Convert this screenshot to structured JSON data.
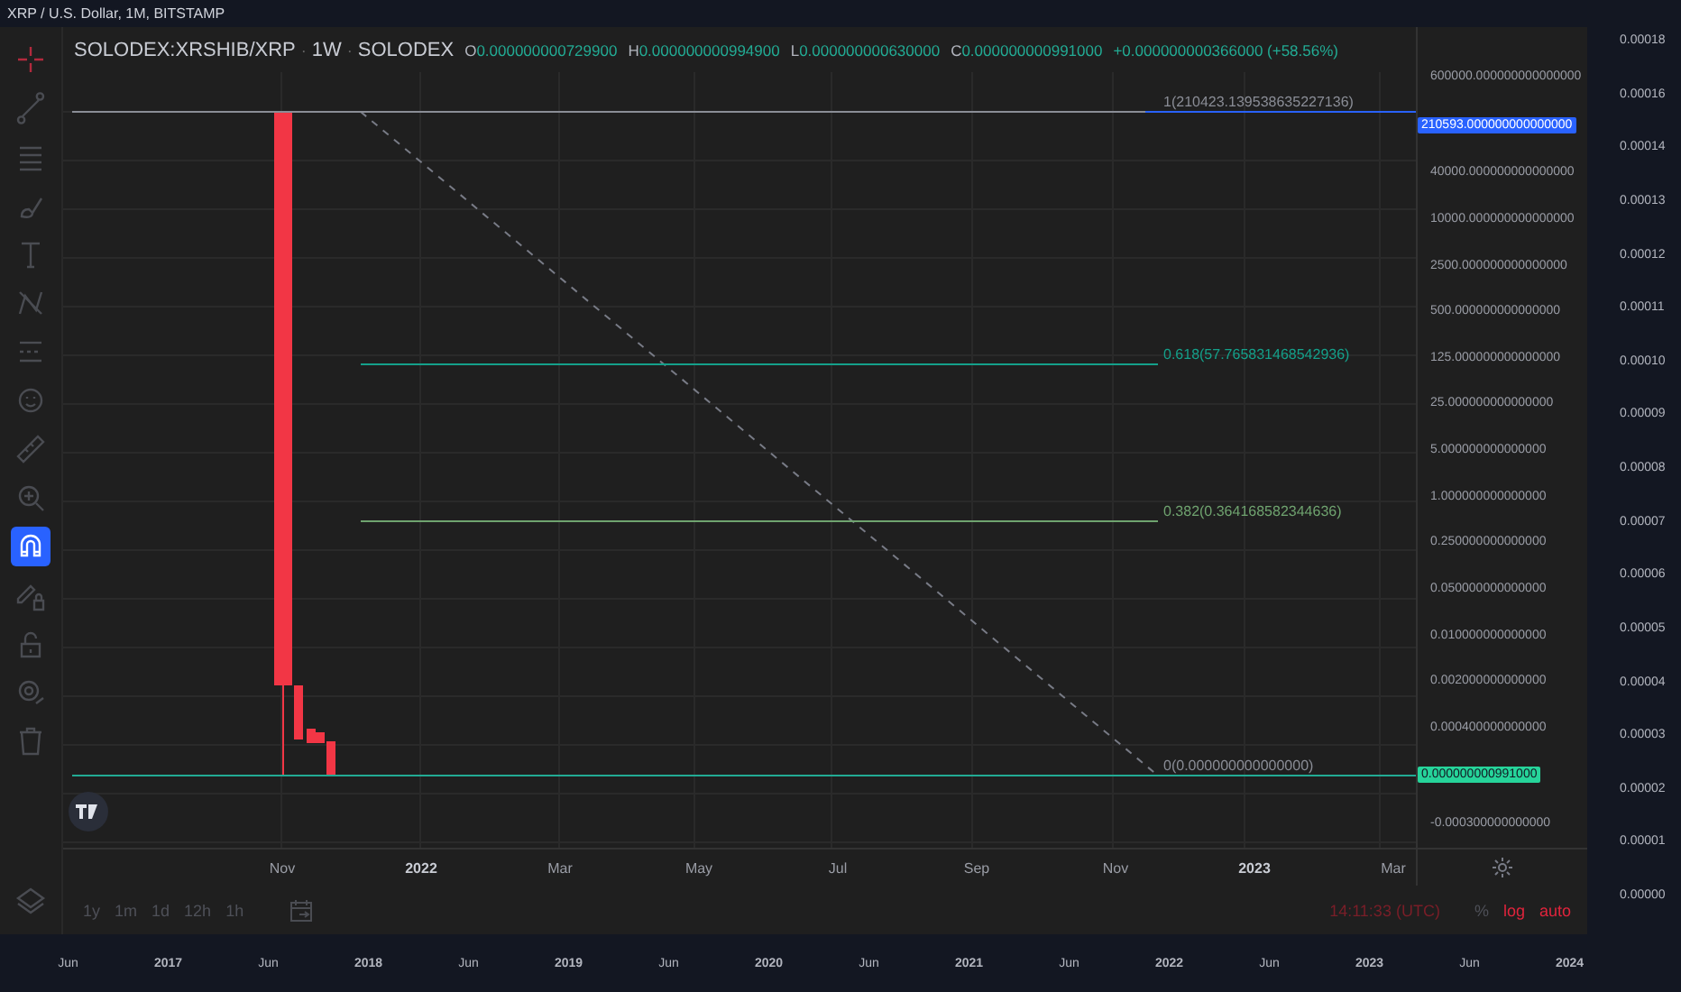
{
  "outer_title": "XRP / U.S. Dollar, 1M, BITSTAMP",
  "outer_price_axis": [
    "0.00018",
    "0.00016",
    "0.00014",
    "0.00013",
    "0.00012",
    "0.00011",
    "0.00010",
    "0.00009",
    "0.00008",
    "0.00007",
    "0.00006",
    "0.00005",
    "0.00004",
    "0.00003",
    "0.00002",
    "0.00001",
    "0.00000"
  ],
  "outer_time_axis": [
    {
      "text": "Jun",
      "kind": "month"
    },
    {
      "text": "2017",
      "kind": "year"
    },
    {
      "text": "Jun",
      "kind": "month"
    },
    {
      "text": "2018",
      "kind": "year"
    },
    {
      "text": "Jun",
      "kind": "month"
    },
    {
      "text": "2019",
      "kind": "year"
    },
    {
      "text": "Jun",
      "kind": "month"
    },
    {
      "text": "2020",
      "kind": "year"
    },
    {
      "text": "Jun",
      "kind": "month"
    },
    {
      "text": "2021",
      "kind": "year"
    },
    {
      "text": "Jun",
      "kind": "month"
    },
    {
      "text": "2022",
      "kind": "year"
    },
    {
      "text": "Jun",
      "kind": "month"
    },
    {
      "text": "2023",
      "kind": "year"
    },
    {
      "text": "Jun",
      "kind": "month"
    },
    {
      "text": "2024",
      "kind": "year"
    }
  ],
  "tools": [
    {
      "kind": "crosshair",
      "selected": false
    },
    {
      "kind": "line",
      "selected": false
    },
    {
      "kind": "hlines",
      "selected": false
    },
    {
      "kind": "brush",
      "selected": false
    },
    {
      "kind": "text",
      "selected": false
    },
    {
      "kind": "zigzag",
      "selected": false
    },
    {
      "kind": "dotted",
      "selected": false
    },
    {
      "kind": "smiley",
      "selected": false
    },
    {
      "kind": "ruler",
      "selected": false
    },
    {
      "kind": "zoom",
      "selected": false
    },
    {
      "kind": "magnet",
      "selected": true
    },
    {
      "kind": "pencil-lock",
      "selected": false
    },
    {
      "kind": "lock",
      "selected": false
    },
    {
      "kind": "eye",
      "selected": false
    },
    {
      "kind": "trash",
      "selected": false
    },
    {
      "kind": "layers",
      "selected": false
    }
  ],
  "legend": {
    "separator": "·",
    "symbol": "SOLODEX:XRSHIB/XRP",
    "interval": "1W",
    "exchange": "SOLODEX",
    "ohlc": [
      {
        "letter": "O",
        "value": "0.000000000729900"
      },
      {
        "letter": "H",
        "value": "0.000000000994900"
      },
      {
        "letter": "L",
        "value": "0.000000000630000"
      },
      {
        "letter": "C",
        "value": "0.000000000991000"
      }
    ],
    "change": "+0.000000000366000 (+58.56%)"
  },
  "fib_levels": [
    {
      "label": "1(210423.139538635227136)",
      "color": "#8a8d96"
    },
    {
      "label": "0.618(57.765831468542936)",
      "color": "#14a08a"
    },
    {
      "label": "0.382(0.364168582344636)",
      "color": "#6fa36f"
    },
    {
      "label": "0(0.000000000000000)",
      "color": "#8a8d96"
    }
  ],
  "price_axis": [
    {
      "kind": "tick",
      "text": "600000.000000000000000"
    },
    {
      "kind": "badge",
      "text": "210593.000000000000000",
      "color": "#2962ff"
    },
    {
      "kind": "tick",
      "text": "40000.000000000000000"
    },
    {
      "kind": "tick",
      "text": "10000.000000000000000"
    },
    {
      "kind": "tick",
      "text": "2500.000000000000000"
    },
    {
      "kind": "tick",
      "text": "500.000000000000000"
    },
    {
      "kind": "tick",
      "text": "125.000000000000000"
    },
    {
      "kind": "tick",
      "text": "25.000000000000000"
    },
    {
      "kind": "tick",
      "text": "5.000000000000000"
    },
    {
      "kind": "tick",
      "text": "1.000000000000000"
    },
    {
      "kind": "tick",
      "text": "0.250000000000000"
    },
    {
      "kind": "tick",
      "text": "0.050000000000000"
    },
    {
      "kind": "tick",
      "text": "0.010000000000000"
    },
    {
      "kind": "tick",
      "text": "0.002000000000000"
    },
    {
      "kind": "tick",
      "text": "0.000400000000000"
    },
    {
      "kind": "badge",
      "text": "0.000000000991000",
      "color": "#26d49a"
    },
    {
      "kind": "tick",
      "text": "-0.000300000000000"
    }
  ],
  "time_axis": [
    {
      "text": "Nov",
      "kind": "month"
    },
    {
      "text": "2022",
      "kind": "year"
    },
    {
      "text": "Mar",
      "kind": "month"
    },
    {
      "text": "May",
      "kind": "month"
    },
    {
      "text": "Jul",
      "kind": "month"
    },
    {
      "text": "Sep",
      "kind": "month"
    },
    {
      "text": "Nov",
      "kind": "month"
    },
    {
      "text": "2023",
      "kind": "year"
    },
    {
      "text": "Mar",
      "kind": "month"
    }
  ],
  "ranges": [
    "1y",
    "1m",
    "1d",
    "12h",
    "1h"
  ],
  "clock": "14:11:33 (UTC)",
  "scale_toggles": [
    {
      "label": "%",
      "on": false
    },
    {
      "label": "log",
      "on": true
    },
    {
      "label": "auto",
      "on": true
    }
  ]
}
